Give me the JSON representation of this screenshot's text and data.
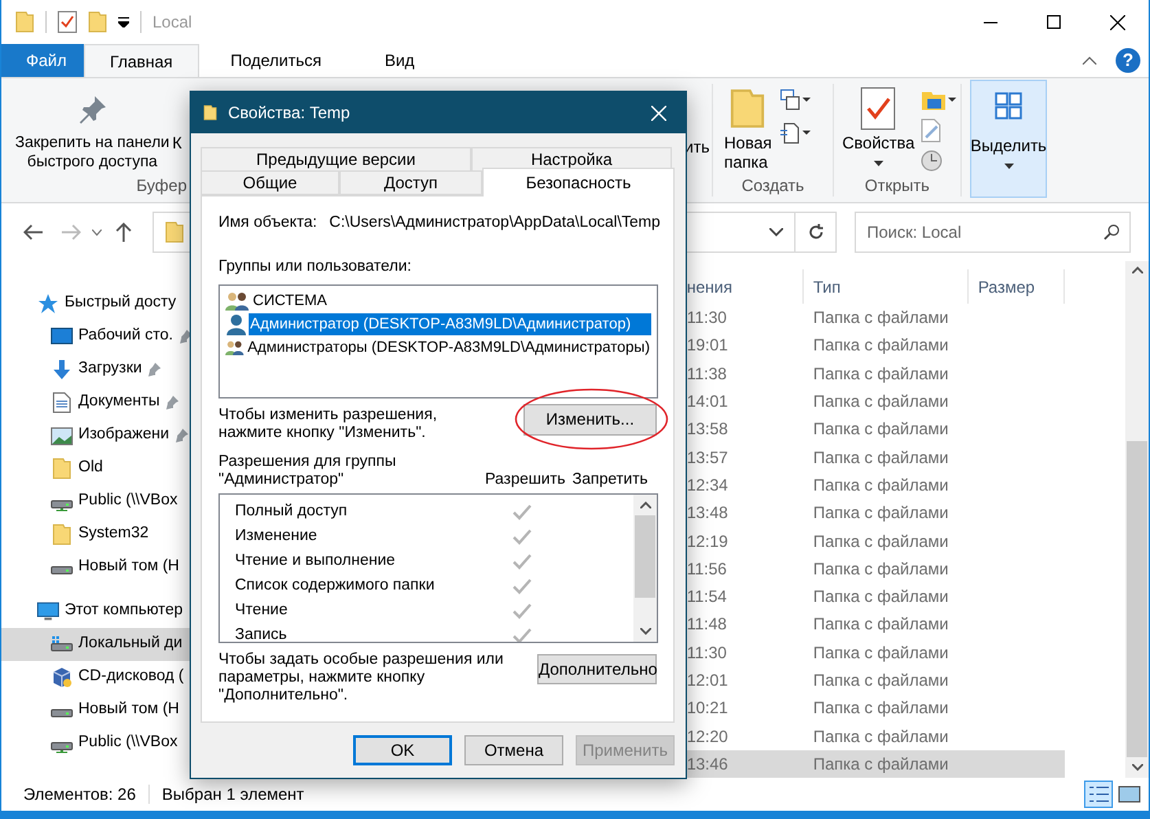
{
  "window": {
    "title": "Local",
    "help": "?"
  },
  "ribbon_tabs": [
    {
      "label": "Файл",
      "kind": "file",
      "selected": false
    },
    {
      "label": "Главная",
      "kind": "tab",
      "selected": true
    },
    {
      "label": "Поделиться",
      "kind": "tab",
      "selected": false
    },
    {
      "label": "Вид",
      "kind": "tab",
      "selected": false
    }
  ],
  "ribbon": {
    "pin_button": "Закрепить на панели\nбыстрого доступа",
    "cut_button": "К",
    "clipboard_group": "Буфер",
    "paste_tail": "ить",
    "new_folder": "Новая\nпапка",
    "create_group": "Создать",
    "properties": "Свойства",
    "open_group": "Открыть",
    "select": "Выделить"
  },
  "search": {
    "placeholder": "Поиск: Local"
  },
  "nav": [
    {
      "label": "Быстрый досту",
      "kind": "quick",
      "children": [
        {
          "label": "Рабочий сто.",
          "kind": "desktop",
          "pinned": true,
          "selected": false
        },
        {
          "label": "Загрузки",
          "kind": "downloads",
          "pinned": true,
          "selected": false
        },
        {
          "label": "Документы",
          "kind": "documents",
          "pinned": true,
          "selected": false
        },
        {
          "label": "Изображени",
          "kind": "pictures",
          "pinned": true,
          "selected": false
        },
        {
          "label": "Old",
          "kind": "folder",
          "pinned": false,
          "selected": false
        },
        {
          "label": "Public (\\\\VBox",
          "kind": "netdrive",
          "pinned": false,
          "selected": false
        },
        {
          "label": "System32",
          "kind": "folder",
          "pinned": false,
          "selected": false
        },
        {
          "label": "Новый том (H",
          "kind": "drive",
          "pinned": false,
          "selected": false
        }
      ]
    },
    {
      "label": "Этот компьютер",
      "kind": "pc",
      "children": [
        {
          "label": "Локальный ди",
          "kind": "sysdrive",
          "pinned": false,
          "selected": true
        },
        {
          "label": "CD-дисковод (",
          "kind": "cd",
          "pinned": false,
          "selected": false
        },
        {
          "label": "Новый том (H",
          "kind": "drive",
          "pinned": false,
          "selected": false
        },
        {
          "label": "Public (\\\\VBox",
          "kind": "netdrive",
          "pinned": false,
          "selected": false
        }
      ]
    }
  ],
  "columns": [
    {
      "label": "нения"
    },
    {
      "label": "Тип"
    },
    {
      "label": "Размер"
    }
  ],
  "rows": [
    {
      "modified": "11:30",
      "type": "Папка с файлами",
      "selected": false
    },
    {
      "modified": "19:01",
      "type": "Папка с файлами",
      "selected": false
    },
    {
      "modified": "11:38",
      "type": "Папка с файлами",
      "selected": false
    },
    {
      "modified": "14:01",
      "type": "Папка с файлами",
      "selected": false
    },
    {
      "modified": "13:58",
      "type": "Папка с файлами",
      "selected": false
    },
    {
      "modified": "13:57",
      "type": "Папка с файлами",
      "selected": false
    },
    {
      "modified": "12:34",
      "type": "Папка с файлами",
      "selected": false
    },
    {
      "modified": "13:48",
      "type": "Папка с файлами",
      "selected": false
    },
    {
      "modified": "12:19",
      "type": "Папка с файлами",
      "selected": false
    },
    {
      "modified": "11:56",
      "type": "Папка с файлами",
      "selected": false
    },
    {
      "modified": "11:54",
      "type": "Папка с файлами",
      "selected": false
    },
    {
      "modified": "11:48",
      "type": "Папка с файлами",
      "selected": false
    },
    {
      "modified": "11:30",
      "type": "Папка с файлами",
      "selected": false
    },
    {
      "modified": "12:01",
      "type": "Папка с файлами",
      "selected": false
    },
    {
      "modified": "10:21",
      "type": "Папка с файлами",
      "selected": false
    },
    {
      "modified": "12:20",
      "type": "Папка с файлами",
      "selected": false
    },
    {
      "modified": "13:46",
      "type": "Папка с файлами",
      "selected": true
    }
  ],
  "status_bar": {
    "count": "Элементов: 26",
    "selection": "Выбран 1 элемент"
  },
  "dialog": {
    "title": "Свойства: Temp",
    "tab_rows": [
      {
        "tabs": [
          {
            "label": "Предыдущие версии",
            "selected": false
          },
          {
            "label": "Настройка",
            "selected": false
          }
        ]
      },
      {
        "tabs": [
          {
            "label": "Общие",
            "selected": false
          },
          {
            "label": "Доступ",
            "selected": false
          },
          {
            "label": "Безопасность",
            "selected": true
          }
        ]
      }
    ],
    "object_label": "Имя объекта:",
    "object_path": "C:\\Users\\Администратор\\AppData\\Local\\Temp",
    "groups_label": "Группы или пользователи:",
    "principals": [
      {
        "name": "СИСТЕМА",
        "kind": "group",
        "selected": false
      },
      {
        "name": "Администратор (DESKTOP-A83M9LD\\Администратор)",
        "kind": "user",
        "selected": true
      },
      {
        "name": "Администраторы (DESKTOP-A83M9LD\\Администраторы)",
        "kind": "group",
        "selected": false
      }
    ],
    "change_hint": "Чтобы изменить разрешения,\nнажмите кнопку \"Изменить\".",
    "change_button": "Изменить...",
    "permissions_title": "Разрешения для группы\n\"Администратор\"",
    "allow_label": "Разрешить",
    "deny_label": "Запретить",
    "permissions": [
      {
        "name": "Полный доступ",
        "allow": true,
        "deny": false
      },
      {
        "name": "Изменение",
        "allow": true,
        "deny": false
      },
      {
        "name": "Чтение и выполнение",
        "allow": true,
        "deny": false
      },
      {
        "name": "Список содержимого папки",
        "allow": true,
        "deny": false
      },
      {
        "name": "Чтение",
        "allow": true,
        "deny": false
      },
      {
        "name": "Запись",
        "allow": true,
        "deny": false
      }
    ],
    "advanced_hint": "Чтобы задать особые разрешения или\nпараметры, нажмите кнопку\n\"Дополнительно\".",
    "advanced_button": "Дополнительно",
    "buttons": [
      {
        "label": "OK",
        "kind": "default",
        "disabled": false
      },
      {
        "label": "Отмена",
        "kind": "normal",
        "disabled": false
      },
      {
        "label": "Применить",
        "kind": "normal",
        "disabled": true
      }
    ]
  }
}
